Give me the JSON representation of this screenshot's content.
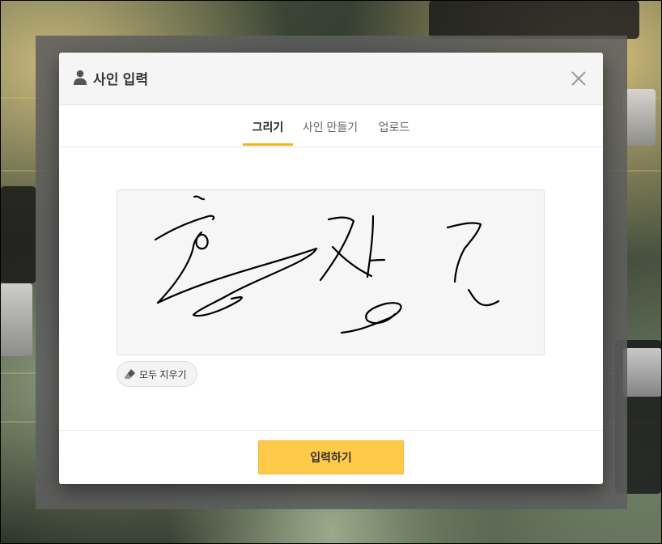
{
  "modal": {
    "title": "사인 입력",
    "title_icon": "user-icon",
    "close_icon": "close-icon"
  },
  "tabs": [
    {
      "label": "그리기",
      "active": true
    },
    {
      "label": "사인 만들기",
      "active": false
    },
    {
      "label": "업로드",
      "active": false
    }
  ],
  "signature_canvas": {
    "has_drawing": true
  },
  "clear_button": {
    "label": "모두 지우기",
    "icon": "eraser-icon"
  },
  "footer": {
    "submit_label": "입력하기"
  },
  "colors": {
    "accent": "#f2b81a",
    "submit_bg": "#ffc94a",
    "overlay": "#5f5f5f"
  }
}
